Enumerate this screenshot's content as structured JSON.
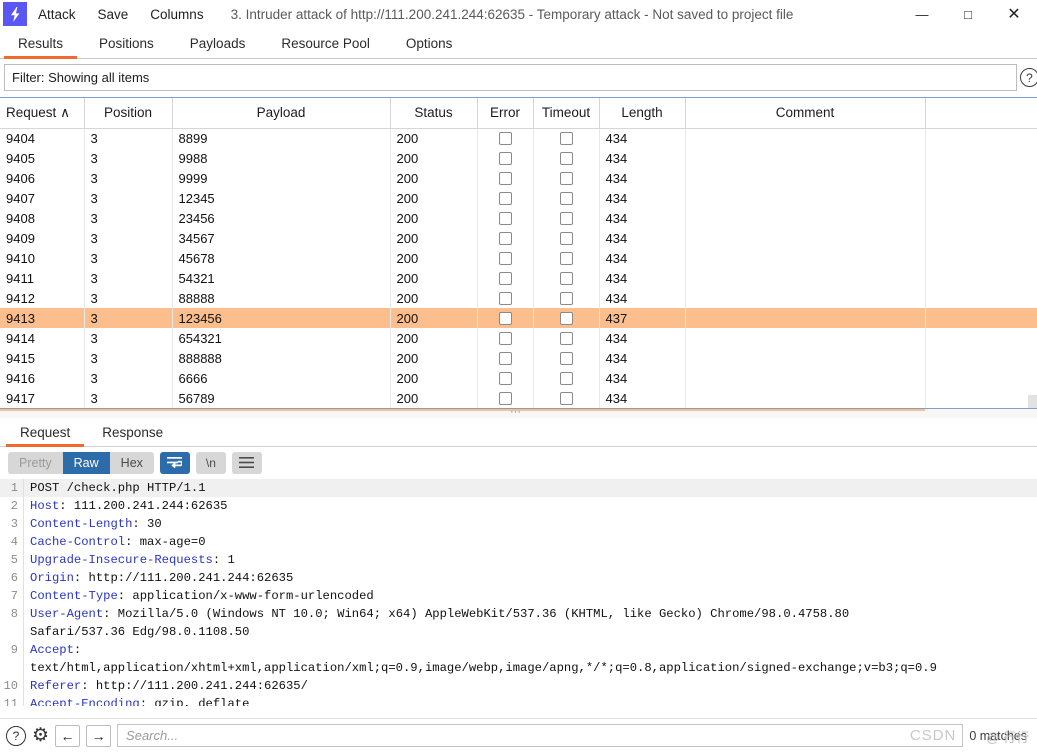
{
  "titlebar": {
    "logo_icon": "lightning-bolt-icon",
    "logo_glyph": "⚡",
    "menus": [
      "Attack",
      "Save",
      "Columns"
    ],
    "window_title": "3. Intruder attack of http://111.200.241.244:62635 - Temporary attack - Not saved to project file",
    "minimize": "—",
    "maximize": "□",
    "close": "✕"
  },
  "tabs": [
    {
      "label": "Results",
      "active": true
    },
    {
      "label": "Positions",
      "active": false
    },
    {
      "label": "Payloads",
      "active": false
    },
    {
      "label": "Resource Pool",
      "active": false
    },
    {
      "label": "Options",
      "active": false
    }
  ],
  "filter": {
    "text": "Filter: Showing all items",
    "help_glyph": "?"
  },
  "table": {
    "columns": [
      "Request",
      "Position",
      "Payload",
      "Status",
      "Error",
      "Timeout",
      "Length",
      "Comment",
      ""
    ],
    "sort_indicator": "∧",
    "rows": [
      {
        "request": "9404",
        "position": "3",
        "payload": "8899",
        "status": "200",
        "error": false,
        "timeout": false,
        "length": "434",
        "comment": "",
        "selected": false
      },
      {
        "request": "9405",
        "position": "3",
        "payload": "9988",
        "status": "200",
        "error": false,
        "timeout": false,
        "length": "434",
        "comment": "",
        "selected": false
      },
      {
        "request": "9406",
        "position": "3",
        "payload": "9999",
        "status": "200",
        "error": false,
        "timeout": false,
        "length": "434",
        "comment": "",
        "selected": false
      },
      {
        "request": "9407",
        "position": "3",
        "payload": "12345",
        "status": "200",
        "error": false,
        "timeout": false,
        "length": "434",
        "comment": "",
        "selected": false
      },
      {
        "request": "9408",
        "position": "3",
        "payload": "23456",
        "status": "200",
        "error": false,
        "timeout": false,
        "length": "434",
        "comment": "",
        "selected": false
      },
      {
        "request": "9409",
        "position": "3",
        "payload": "34567",
        "status": "200",
        "error": false,
        "timeout": false,
        "length": "434",
        "comment": "",
        "selected": false
      },
      {
        "request": "9410",
        "position": "3",
        "payload": "45678",
        "status": "200",
        "error": false,
        "timeout": false,
        "length": "434",
        "comment": "",
        "selected": false
      },
      {
        "request": "9411",
        "position": "3",
        "payload": "54321",
        "status": "200",
        "error": false,
        "timeout": false,
        "length": "434",
        "comment": "",
        "selected": false
      },
      {
        "request": "9412",
        "position": "3",
        "payload": "88888",
        "status": "200",
        "error": false,
        "timeout": false,
        "length": "434",
        "comment": "",
        "selected": false
      },
      {
        "request": "9413",
        "position": "3",
        "payload": "123456",
        "status": "200",
        "error": false,
        "timeout": false,
        "length": "437",
        "comment": "",
        "selected": true
      },
      {
        "request": "9414",
        "position": "3",
        "payload": "654321",
        "status": "200",
        "error": false,
        "timeout": false,
        "length": "434",
        "comment": "",
        "selected": false
      },
      {
        "request": "9415",
        "position": "3",
        "payload": "888888",
        "status": "200",
        "error": false,
        "timeout": false,
        "length": "434",
        "comment": "",
        "selected": false
      },
      {
        "request": "9416",
        "position": "3",
        "payload": "6666",
        "status": "200",
        "error": false,
        "timeout": false,
        "length": "434",
        "comment": "",
        "selected": false
      },
      {
        "request": "9417",
        "position": "3",
        "payload": "56789",
        "status": "200",
        "error": false,
        "timeout": false,
        "length": "434",
        "comment": "",
        "selected": false
      }
    ]
  },
  "message_tabs": [
    {
      "label": "Request",
      "active": true
    },
    {
      "label": "Response",
      "active": false
    }
  ],
  "editor_toolbar": {
    "pretty": "Pretty",
    "raw": "Raw",
    "hex": "Hex",
    "wrap_icon": "word-wrap-icon",
    "newline_label": "\\n",
    "menu_icon": "hamburger-menu-icon"
  },
  "request_lines": [
    {
      "n": "1",
      "head": "",
      "rest": "POST /check.php HTTP/1.1"
    },
    {
      "n": "2",
      "head": "Host",
      "rest": ": 111.200.241.244:62635"
    },
    {
      "n": "3",
      "head": "Content-Length",
      "rest": ": 30"
    },
    {
      "n": "4",
      "head": "Cache-Control",
      "rest": ": max-age=0"
    },
    {
      "n": "5",
      "head": "Upgrade-Insecure-Requests",
      "rest": ": 1"
    },
    {
      "n": "6",
      "head": "Origin",
      "rest": ": http://111.200.241.244:62635"
    },
    {
      "n": "7",
      "head": "Content-Type",
      "rest": ": application/x-www-form-urlencoded"
    },
    {
      "n": "8",
      "head": "User-Agent",
      "rest": ": Mozilla/5.0 (Windows NT 10.0; Win64; x64) AppleWebKit/537.36 (KHTML, like Gecko) Chrome/98.0.4758.80"
    },
    {
      "n": "",
      "head": "",
      "rest": "Safari/537.36 Edg/98.0.1108.50"
    },
    {
      "n": "9",
      "head": "Accept",
      "rest": ":"
    },
    {
      "n": "",
      "head": "",
      "rest": "text/html,application/xhtml+xml,application/xml;q=0.9,image/webp,image/apng,*/*;q=0.8,application/signed-exchange;v=b3;q=0.9"
    },
    {
      "n": "10",
      "head": "Referer",
      "rest": ": http://111.200.241.244:62635/"
    },
    {
      "n": "11",
      "head": "Accept-Encoding",
      "rest": ": gzip, deflate"
    }
  ],
  "bottom": {
    "help_glyph": "?",
    "gear_glyph": "⚙",
    "back_glyph": "←",
    "forward_glyph": "→",
    "search_placeholder": "Search...",
    "watermark": "CSDN",
    "matches": "0 matches",
    "corner_watermark": "@ 行行"
  },
  "colors": {
    "accent_orange": "#ef6a2e",
    "row_highlight": "#fbbe8c",
    "selected_blue": "#2c6ca8",
    "logo_purple": "#5b57f5",
    "header_name_blue": "#2a35c4"
  }
}
